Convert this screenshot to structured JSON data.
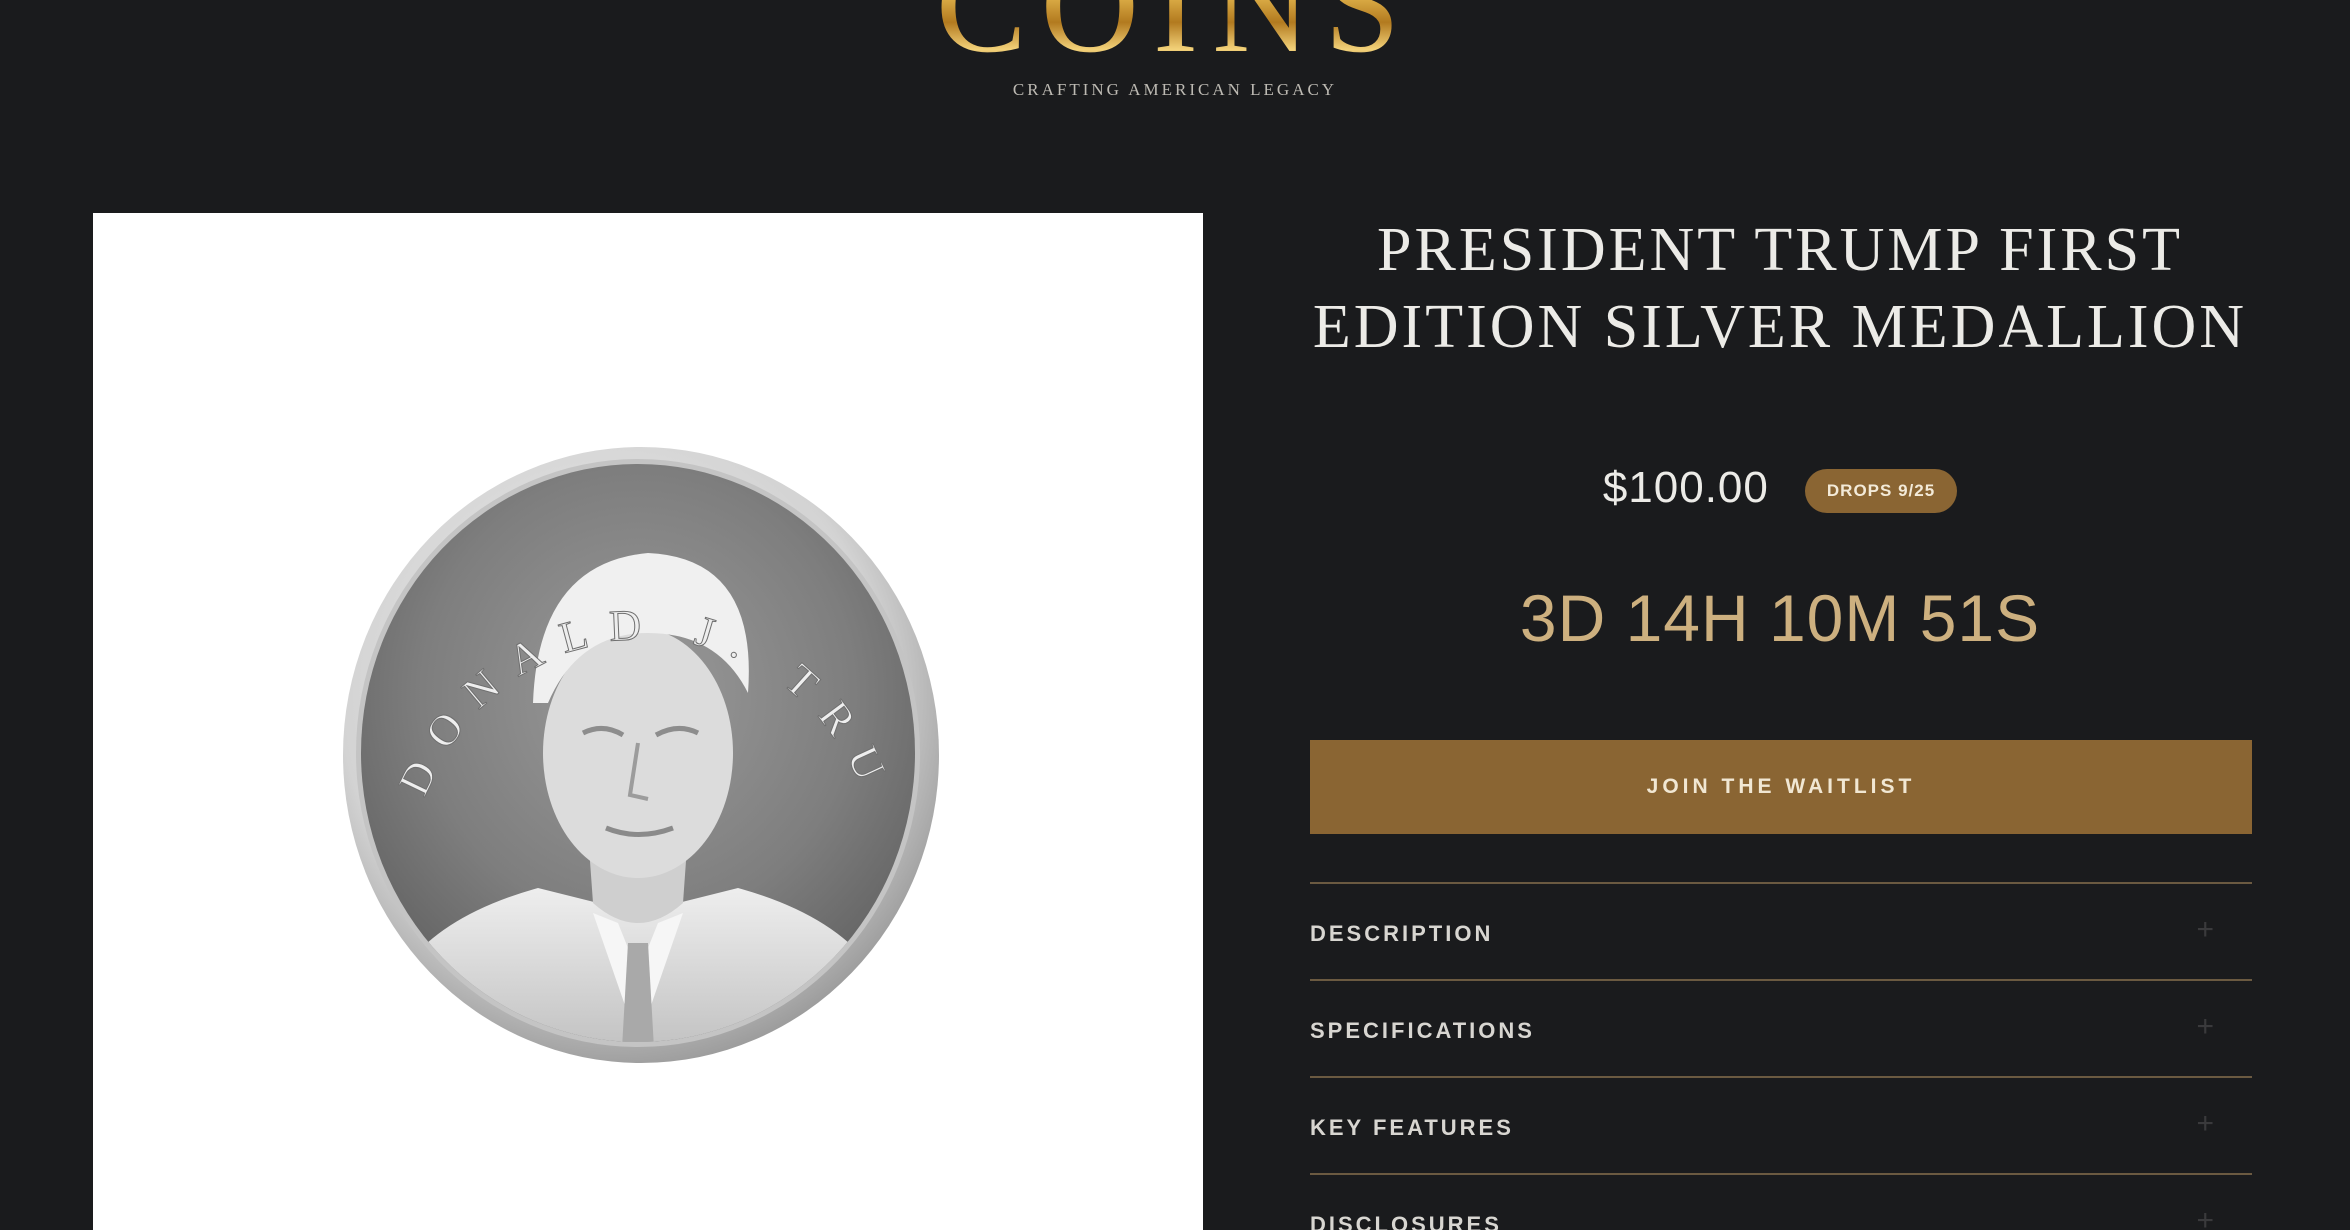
{
  "header": {
    "logo_word": "COINS",
    "tagline": "CRAFTING AMERICAN LEGACY"
  },
  "product": {
    "image_alt": "President Trump silver medallion",
    "medallion_inscription": "DONALD J. TRUMP",
    "title": "PRESIDENT TRUMP FIRST EDITION SILVER MEDALLION",
    "price": "$100.00",
    "badge": "DROPS 9/25",
    "countdown": "3D 14H 10M 51S",
    "cta_label": "JOIN THE WAITLIST"
  },
  "accordion": {
    "items": [
      {
        "label": "DESCRIPTION",
        "icon": "plus-icon"
      },
      {
        "label": "SPECIFICATIONS",
        "icon": "plus-icon"
      },
      {
        "label": "KEY FEATURES",
        "icon": "plus-icon"
      },
      {
        "label": "DISCLOSURES",
        "icon": "plus-icon"
      }
    ]
  },
  "colors": {
    "background": "#1a1b1d",
    "accent_gold": "#8a6533",
    "countdown_gold": "#cdb07f",
    "divider": "#6b5a41",
    "text_light": "#ecebe7"
  }
}
